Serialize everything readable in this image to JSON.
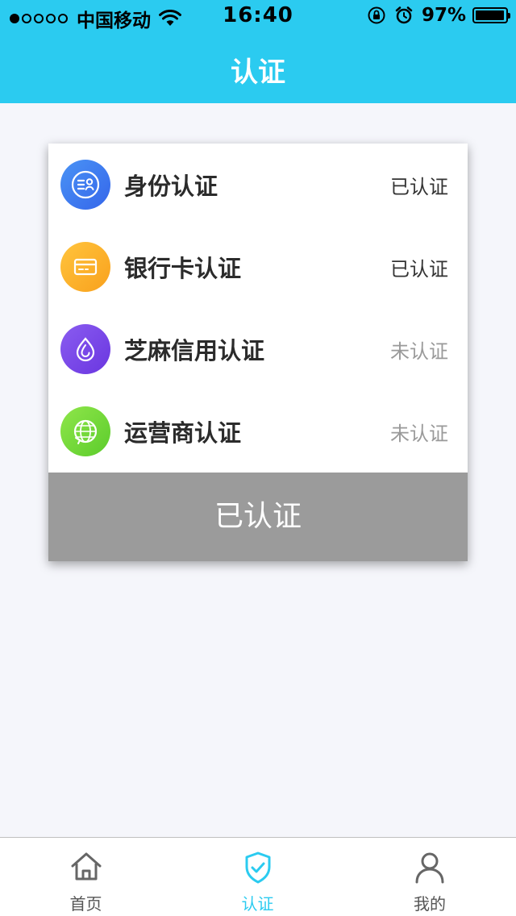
{
  "status_bar": {
    "carrier": "中国移动",
    "time": "16:40",
    "battery": "97%",
    "battery_level": 0.97
  },
  "nav": {
    "title": "认证"
  },
  "verifications": [
    {
      "label": "身份认证",
      "status": "已认证",
      "icon": "id-card-icon",
      "verified": true
    },
    {
      "label": "银行卡认证",
      "status": "已认证",
      "icon": "bank-card-icon",
      "verified": true
    },
    {
      "label": "芝麻信用认证",
      "status": "未认证",
      "icon": "sesame-credit-icon",
      "verified": false
    },
    {
      "label": "运营商认证",
      "status": "未认证",
      "icon": "globe-phone-icon",
      "verified": false
    }
  ],
  "submit_button": {
    "label": "已认证"
  },
  "tabs": [
    {
      "label": "首页",
      "icon": "home-icon",
      "active": false
    },
    {
      "label": "认证",
      "icon": "shield-check-icon",
      "active": true
    },
    {
      "label": "我的",
      "icon": "user-icon",
      "active": false
    }
  ],
  "colors": {
    "header": "#2bcbf0",
    "active_tab": "#2bcbf0",
    "inactive_tab": "#555555",
    "button_disabled": "#9b9b9b",
    "id_icon": "#3d7af0",
    "bank_icon": "#fbb12b",
    "sesame_icon": "#7a4ae8",
    "carrier_icon": "#74d83a"
  }
}
